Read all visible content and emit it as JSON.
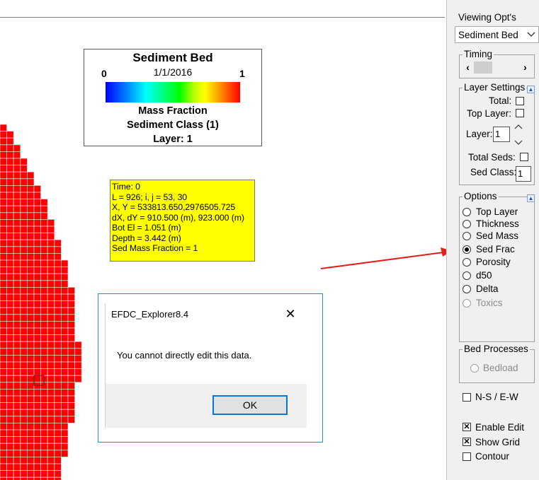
{
  "map": {
    "cell_color": "#ff0000",
    "grid_color": "#d0d0d0"
  },
  "legend": {
    "title": "Sediment Bed",
    "date": "1/1/2016",
    "min": "0",
    "max": "1",
    "line1": "Mass Fraction",
    "line2": "Sediment Class (1)",
    "line3": "Layer: 1"
  },
  "info": {
    "lines": [
      "Time: 0",
      "L =  926;  i, j =  53, 30",
      "X, Y = 533813.650,2976505.725",
      "dX, dY = 910.500 (m), 923.000 (m)",
      "Bot El = 1.051 (m)",
      "Depth =  3.442 (m)",
      "Sed Mass Fraction =  1"
    ]
  },
  "dialog": {
    "title": "EFDC_Explorer8.4",
    "close_icon": "✕",
    "message": "You cannot directly edit this data.",
    "ok_label": "OK"
  },
  "panel": {
    "viewing_label": "Viewing Opt's",
    "viewing_value": "Sediment Bed",
    "timing_label": "Timing",
    "layer_settings_label": "Layer Settings",
    "total_label": "Total:",
    "top_layer_label": "Top Layer:",
    "layer_label": "Layer:",
    "layer_value": "1",
    "total_seds_label": "Total Seds:",
    "sed_class_label": "Sed Class:",
    "sed_class_value": "1",
    "options_label": "Options",
    "options": [
      {
        "label": "Top Layer",
        "selected": false,
        "enabled": true
      },
      {
        "label": "Thickness",
        "selected": false,
        "enabled": true
      },
      {
        "label": "Sed Mass",
        "selected": false,
        "enabled": true
      },
      {
        "label": "Sed Frac",
        "selected": true,
        "enabled": true
      },
      {
        "label": "Porosity",
        "selected": false,
        "enabled": true
      },
      {
        "label": "d50",
        "selected": false,
        "enabled": true
      },
      {
        "label": "Delta",
        "selected": false,
        "enabled": true
      },
      {
        "label": "Toxics",
        "selected": false,
        "enabled": false
      }
    ],
    "bed_processes_label": "Bed Processes",
    "bedload_label": "Bedload",
    "ns_ew_label": "N-S / E-W",
    "enable_edit_label": "Enable Edit",
    "show_grid_label": "Show Grid",
    "contour_label": "Contour"
  },
  "colors": {
    "accent": "#0078d7",
    "arrow": "#e0201c",
    "info_bg": "#ffff00"
  }
}
